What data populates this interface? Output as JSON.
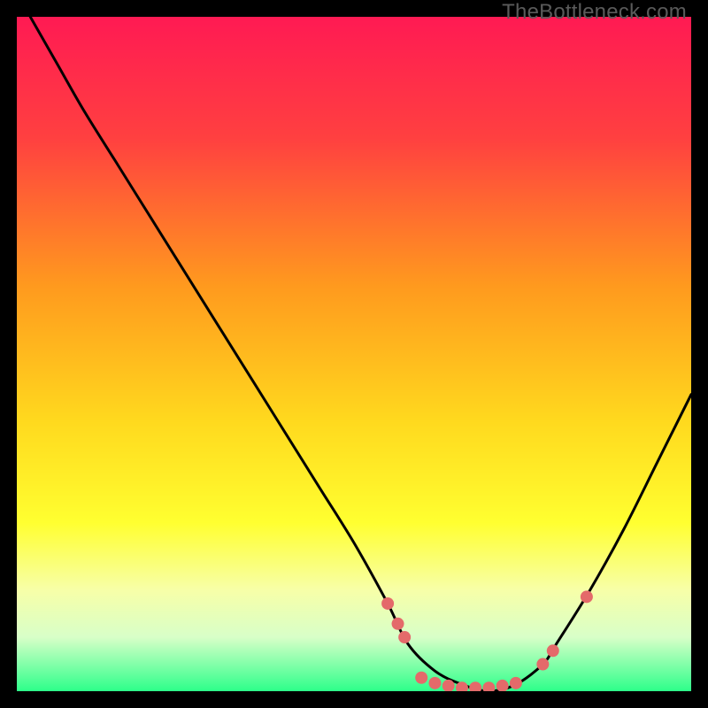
{
  "watermark": "TheBottleneck.com",
  "chart_data": {
    "type": "line",
    "title": "",
    "xlabel": "",
    "ylabel": "",
    "xlim": [
      0,
      100
    ],
    "ylim": [
      0,
      100
    ],
    "grid": false,
    "legend": false,
    "gradient_stops": [
      {
        "offset": 0,
        "color": "#ff1a53"
      },
      {
        "offset": 18,
        "color": "#ff4040"
      },
      {
        "offset": 40,
        "color": "#ff9a1e"
      },
      {
        "offset": 60,
        "color": "#ffd91e"
      },
      {
        "offset": 75,
        "color": "#ffff30"
      },
      {
        "offset": 85,
        "color": "#f7ffa8"
      },
      {
        "offset": 92,
        "color": "#d8ffc8"
      },
      {
        "offset": 100,
        "color": "#2dff8a"
      }
    ],
    "series": [
      {
        "name": "bottleneck-curve",
        "x": [
          2,
          6,
          10,
          15,
          20,
          25,
          30,
          35,
          40,
          45,
          50,
          55,
          58,
          62,
          66,
          70,
          74,
          78,
          80,
          85,
          90,
          95,
          100
        ],
        "y": [
          100,
          93,
          86,
          78,
          70,
          62,
          54,
          46,
          38,
          30,
          22,
          13,
          7,
          3,
          1,
          0,
          1,
          4,
          7,
          15,
          24,
          34,
          44
        ]
      }
    ],
    "markers": [
      {
        "x": 55.0,
        "y": 13.0
      },
      {
        "x": 56.5,
        "y": 10.0
      },
      {
        "x": 57.5,
        "y": 8.0
      },
      {
        "x": 60.0,
        "y": 2.0
      },
      {
        "x": 62.0,
        "y": 1.2
      },
      {
        "x": 64.0,
        "y": 0.8
      },
      {
        "x": 66.0,
        "y": 0.5
      },
      {
        "x": 68.0,
        "y": 0.5
      },
      {
        "x": 70.0,
        "y": 0.5
      },
      {
        "x": 72.0,
        "y": 0.8
      },
      {
        "x": 74.0,
        "y": 1.2
      },
      {
        "x": 78.0,
        "y": 4.0
      },
      {
        "x": 79.5,
        "y": 6.0
      },
      {
        "x": 84.5,
        "y": 14.0
      }
    ],
    "marker_style": {
      "color": "#e46a6a",
      "radius": 7
    }
  }
}
